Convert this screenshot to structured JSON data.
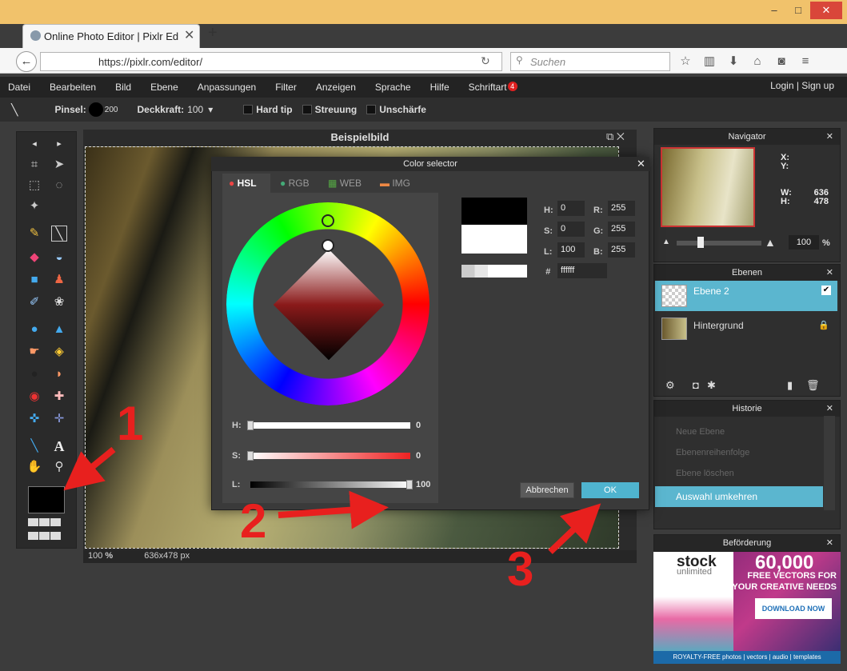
{
  "browser": {
    "tab_title": "Online Photo Editor | Pixlr Ed",
    "url": "https://pixlr.com/editor/",
    "search_placeholder": "Suchen",
    "win_min": "–",
    "win_max": "□",
    "win_close": "✕"
  },
  "menu": {
    "items": [
      "Datei",
      "Bearbeiten",
      "Bild",
      "Ebene",
      "Anpassungen",
      "Filter",
      "Anzeigen",
      "Sprache",
      "Hilfe",
      "Schriftart"
    ],
    "badge": "4",
    "login": "Login",
    "signup": "Sign up"
  },
  "options": {
    "brush_label": "Pinsel:",
    "brush_size": "200",
    "opacity_label": "Deckkraft:",
    "opacity_value": "100",
    "hard_tip": "Hard tip",
    "scatter": "Streuung",
    "blur": "Unschärfe"
  },
  "document": {
    "title": "Beispielbild",
    "zoom": "100",
    "zoom_unit": "%",
    "size": "636x478 px"
  },
  "navigator": {
    "title": "Navigator",
    "x_label": "X:",
    "y_label": "Y:",
    "w_label": "W:",
    "h_label": "H:",
    "w": "636",
    "h": "478",
    "zoom": "100",
    "zoom_unit": "%"
  },
  "layers": {
    "title": "Ebenen",
    "items": [
      {
        "name": "Ebene 2"
      },
      {
        "name": "Hintergrund"
      }
    ]
  },
  "history": {
    "title": "Historie",
    "items": [
      "Neue Ebene",
      "Ebenenreihenfolge",
      "Ebene löschen",
      "Auswahl umkehren"
    ]
  },
  "ad": {
    "title": "Beförderung",
    "brand": "stock",
    "brand_sub": "unlimited",
    "headline": "60,000",
    "line1": "FREE VECTORS FOR",
    "line2": "YOUR CREATIVE NEEDS",
    "cta": "DOWNLOAD NOW",
    "footer": "ROYALTY-FREE photos | vectors | audio | templates"
  },
  "dialog": {
    "title": "Color selector",
    "tabs": [
      "HSL",
      "RGB",
      "WEB",
      "IMG"
    ],
    "fields": {
      "H": "0",
      "S": "0",
      "L": "100",
      "R": "255",
      "G": "255",
      "B": "255",
      "hex_label": "#",
      "hex": "ffffff"
    },
    "sliders": [
      {
        "label": "H:",
        "value": "0",
        "fraction": 0
      },
      {
        "label": "S:",
        "value": "0",
        "fraction": 0
      },
      {
        "label": "L:",
        "value": "100",
        "fraction": 1
      }
    ],
    "cancel": "Abbrechen",
    "ok": "OK"
  },
  "annotations": [
    "1",
    "2",
    "3"
  ],
  "colors": {
    "accent": "#4fb4cf",
    "arrow": "#e8201e",
    "panel": "#2f2f2f"
  }
}
